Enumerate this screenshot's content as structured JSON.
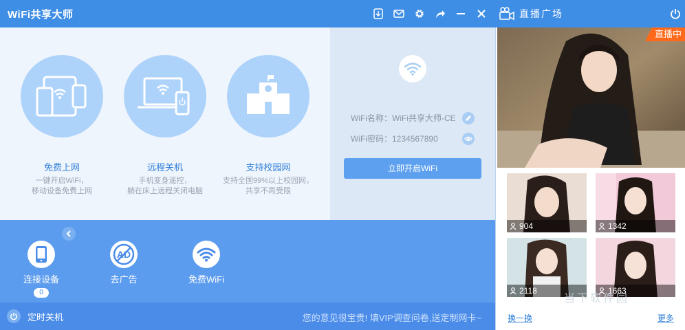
{
  "app": {
    "title": "WiFi共享大师",
    "live_plaza_label": "直播广场"
  },
  "title_icons": [
    "download-icon",
    "mail-icon",
    "gear-icon",
    "share-icon",
    "minimize-icon",
    "close-icon",
    "camera-icon",
    "power-icon"
  ],
  "features": [
    {
      "title": "免费上网",
      "desc": "一键开启WiFi，\n移动设备免费上网"
    },
    {
      "title": "远程关机",
      "desc": "手机变身遥控，\n躺在床上远程关闭电脑"
    },
    {
      "title": "支持校园网",
      "desc": "支持全国99%以上校园网，\n共享不再受限"
    }
  ],
  "wifi": {
    "name_label": "WiFi名称：",
    "name_value": "WiFi共享大师-CE",
    "password_label": "WiFi密码：",
    "password_value": "1234567890",
    "open_button": "立即开启WiFi"
  },
  "tools": [
    {
      "label": "连接设备",
      "badge": "0"
    },
    {
      "label": "去广告"
    },
    {
      "label": "免费WiFi"
    }
  ],
  "status": {
    "timer_label": "定时关机",
    "feedback": "您的意见很宝贵! 填VIP调查问卷,送定制网卡~"
  },
  "live": {
    "tag": "直播中",
    "viewers": [
      "904",
      "1342",
      "2118",
      "1663"
    ],
    "swap_link": "换一换",
    "more_link": "更多",
    "watermark": "当下软件园"
  },
  "colors": {
    "titlebar": "#3f8ee6",
    "accent": "#5b9cee",
    "live_tag": "#ff6a1a"
  }
}
